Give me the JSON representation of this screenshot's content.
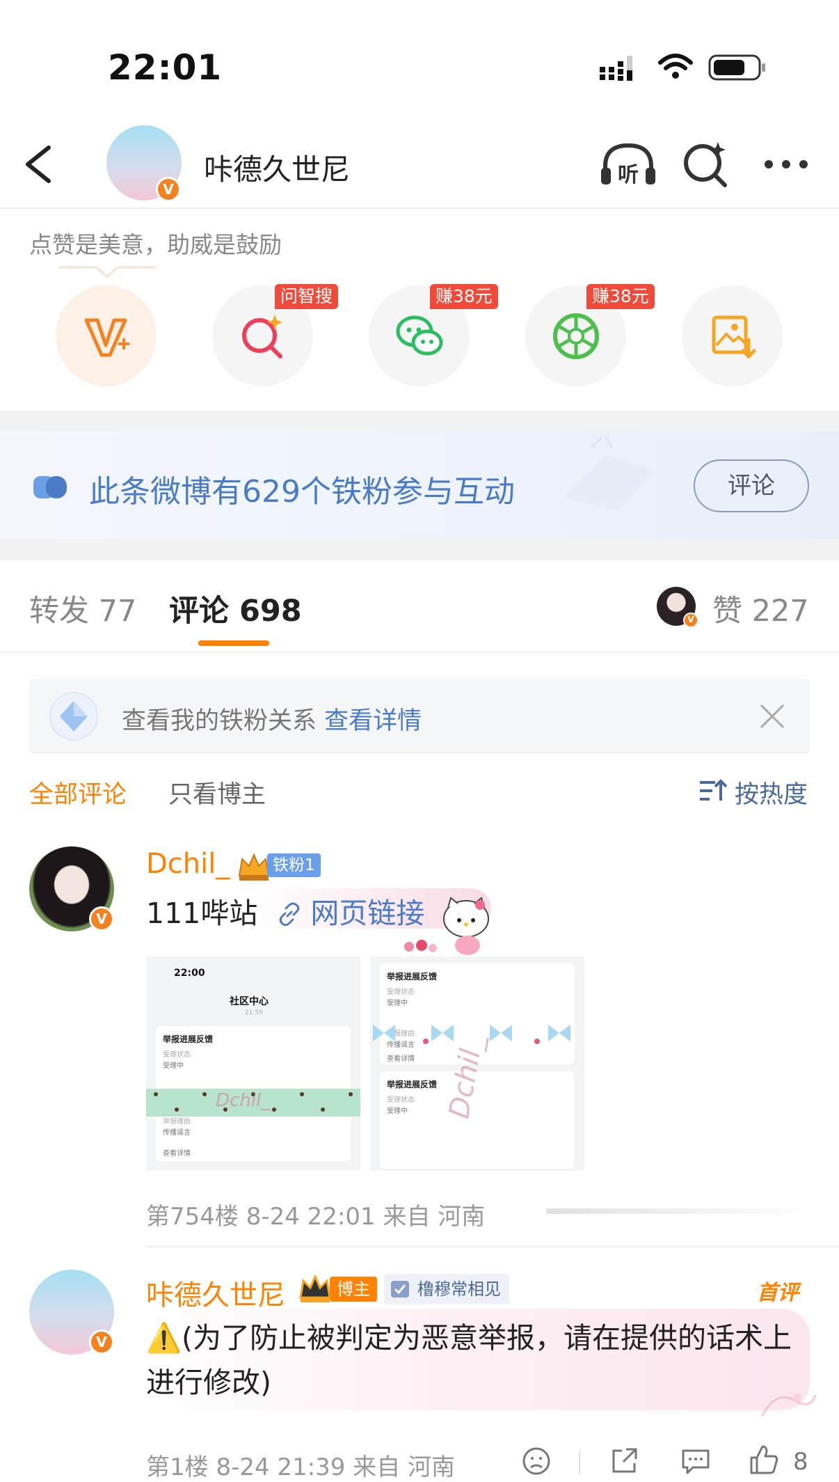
{
  "status_bar": {
    "time": "22:01"
  },
  "nav": {
    "title": "咔德久世尼"
  },
  "tip": "点赞是美意，助威是鼓励",
  "actions": [
    {
      "icon": "v-plus-icon",
      "badge": ""
    },
    {
      "icon": "search-ai-icon",
      "badge": "问智搜"
    },
    {
      "icon": "wechat-icon",
      "badge": "赚38元"
    },
    {
      "icon": "moments-icon",
      "badge": "赚38元"
    },
    {
      "icon": "save-image-icon",
      "badge": ""
    }
  ],
  "banner": {
    "text": "此条微博有629个铁粉参与互动",
    "button": "评论"
  },
  "tabs": {
    "repost": "转发 77",
    "comment": "评论 698",
    "like": "赞 227"
  },
  "fan_box": {
    "text": "查看我的铁粉关系",
    "link": "查看详情"
  },
  "filters": {
    "all": "全部评论",
    "author_only": "只看博主",
    "sort": "按热度"
  },
  "comments": [
    {
      "user": "Dchil_",
      "badge": "铁粉1",
      "text": "111哔站",
      "link": "网页链接",
      "meta": "第754楼 8-24 22:01 来自 河南",
      "images": [
        {
          "time": "22:00",
          "title": "社区中心",
          "subtitle": "21:59",
          "card1": "举报进展反馈",
          "status_label": "受理状态",
          "status": "受理中",
          "reason_label": "举报理由",
          "reason": "传播谣言",
          "detail": "查看详情",
          "watermark": "Dchil_"
        },
        {
          "card1": "举报进展反馈",
          "status_label": "受理状态",
          "status": "受理中",
          "reason_label": "举报理由",
          "reason": "传播谣言",
          "detail": "查看详情",
          "watermark": "Dchil_"
        }
      ]
    },
    {
      "user": "咔德久世尼",
      "badge": "博主",
      "tag": "橹穆常相见",
      "first_badge": "首评",
      "text": "⚠️(为了防止被判定为恶意举报，请在提供的话术上进行修改)",
      "meta": "第1楼 8-24 21:39 来自 河南",
      "likes": "8"
    }
  ]
}
